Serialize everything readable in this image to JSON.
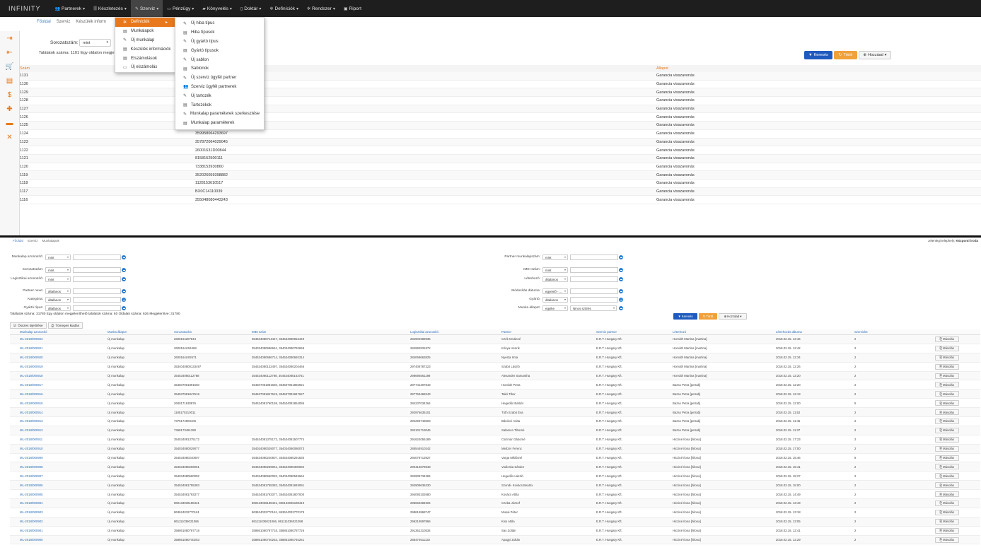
{
  "brand": "INFINITY",
  "nav": [
    {
      "label": "Partnerek",
      "icon": "users-icon"
    },
    {
      "label": "Készletezés",
      "icon": "barcode-icon"
    },
    {
      "label": "Szerviz",
      "icon": "wrench-icon"
    },
    {
      "label": "Pénzügy",
      "icon": "money-icon"
    },
    {
      "label": "Könyvelés",
      "icon": "folder-icon"
    },
    {
      "label": "Doktár",
      "icon": "file-icon"
    },
    {
      "label": "Definíciók",
      "icon": "gear-icon"
    },
    {
      "label": "Rendszer",
      "icon": "gears-icon"
    },
    {
      "label": "Riport",
      "icon": "report-icon"
    }
  ],
  "crumbs": {
    "home": "Főoldal",
    "c2": "Szerviz",
    "c3": "Készülék inform"
  },
  "top": {
    "serial_label": "Sorozatszám:",
    "serial_select": "mint",
    "found": "Találatok száma: 1101 Egy oldalon megje",
    "search": "Keresés",
    "clear": "Töröl",
    "add": "Hozzáad"
  },
  "table1": {
    "col_szam": "Szám",
    "col_allapot": "Állapot",
    "rows": [
      {
        "szam": "1131",
        "serial": "",
        "allapot": "Garancia visszavonás"
      },
      {
        "szam": "1130",
        "serial": "",
        "allapot": "Garancia visszavonás"
      },
      {
        "szam": "1129",
        "serial": "",
        "allapot": "Garancia visszavonás"
      },
      {
        "szam": "1128",
        "serial": "",
        "allapot": "Garancia visszavonás"
      },
      {
        "szam": "1127",
        "serial": "",
        "allapot": "Garancia visszavonás"
      },
      {
        "szam": "1126",
        "serial": "2600791400988",
        "allapot": "Garancia visszavonás"
      },
      {
        "szam": "1125",
        "serial": "352026059383100",
        "allapot": "Garancia visszavonás"
      },
      {
        "szam": "1124",
        "serial": "359958064293697",
        "allapot": "Garancia visszavonás"
      },
      {
        "szam": "1123",
        "serial": "357872064029045",
        "allapot": "Garancia visszavonás"
      },
      {
        "szam": "1122",
        "serial": "26001631D00844",
        "allapot": "Garancia visszavonás"
      },
      {
        "szam": "1121",
        "serial": "8158152500111",
        "allapot": "Garancia visszavonás"
      },
      {
        "szam": "1120",
        "serial": "7338153930860",
        "allapot": "Garancia visszavonás"
      },
      {
        "szam": "1119",
        "serial": "352026059398882",
        "allapot": "Garancia visszavonás"
      },
      {
        "szam": "1118",
        "serial": "1128153610517",
        "allapot": "Garancia visszavonás"
      },
      {
        "szam": "1117",
        "serial": "BX0C14110039",
        "allapot": "Garancia visszavonás"
      },
      {
        "szam": "1116",
        "serial": "355048080443243",
        "allapot": "Garancia visszavonás"
      }
    ]
  },
  "szerviz_menu": [
    {
      "label": "Definíciók",
      "icon": "gear-icon",
      "active": true
    },
    {
      "label": "Munkalapok",
      "icon": "list-icon"
    },
    {
      "label": "Új munkalap",
      "icon": "wrench-icon"
    },
    {
      "label": "Készülék információk",
      "icon": "list-icon"
    },
    {
      "label": "Elszámolások",
      "icon": "list-icon"
    },
    {
      "label": "Új elszámolás",
      "icon": "money-icon"
    }
  ],
  "def_menu": [
    {
      "label": "Új hiba típus",
      "icon": "edit-icon"
    },
    {
      "label": "Hiba típusok",
      "icon": "list-icon"
    },
    {
      "label": "Új gyártó típus",
      "icon": "edit-icon"
    },
    {
      "label": "Gyártó típusok",
      "icon": "list-icon"
    },
    {
      "label": "Új sablon",
      "icon": "edit-icon"
    },
    {
      "label": "Sablonok",
      "icon": "list-icon"
    },
    {
      "label": "Új szerviz ügyfél partner",
      "icon": "edit-icon"
    },
    {
      "label": "Szerviz ügyfél partnerek",
      "icon": "users-icon"
    },
    {
      "label": "Új tartozék",
      "icon": "edit-icon"
    },
    {
      "label": "Tartozékok",
      "icon": "list-icon"
    },
    {
      "label": "Munkalap paraméterek szerkesztése",
      "icon": "edit-icon"
    },
    {
      "label": "Munkalap paraméterek",
      "icon": "list-icon"
    }
  ],
  "p2": {
    "crumbs": {
      "home": "Főoldal",
      "c2": "Szerviz",
      "c3": "Munkalapok"
    },
    "site_label": "Jelenlegi telephely:",
    "site": "Központi iroda",
    "filters_left": [
      {
        "label": "Munkalap azonosító:",
        "select": "mint"
      },
      {
        "label": "Sorozatszám:",
        "select": "mint"
      },
      {
        "label": "Logisztikai azonosító:",
        "select": "mint"
      },
      {
        "label": "Partner neve:",
        "select": "általános"
      },
      {
        "label": "Kategória:",
        "select": "általános"
      },
      {
        "label": "Gyártó típus:",
        "select": "általános"
      }
    ],
    "filters_right": [
      {
        "label": "Partner munkalapszám:",
        "select": "mint"
      },
      {
        "label": "IMEI szám:",
        "select": "mint"
      },
      {
        "label": "Létrehozó:",
        "select": "általános"
      },
      {
        "label": "Módosítás dátuma:",
        "select": "egyenlő - ..."
      },
      {
        "label": "Gyártó:",
        "select": "általános"
      },
      {
        "label": "Munka állapot:",
        "select": "egyike",
        "select2": "Nincs szűrés"
      }
    ],
    "found": "Találatok száma: 31780 Egy oldalon megjeleníthető találatok száma: 60 Oldalak száma: 636 Megjelenítve: 31780",
    "search": "Keresés",
    "clear": "Töröl",
    "add": "Hozzáad",
    "tab1": "Összes kijelölése",
    "tab2": "Tömeges kiadás",
    "headers": [
      "Munkalap azonosító",
      "Munka állapot",
      "Sorozatszám",
      "IMEI szám",
      "Logisztikai azonosító",
      "Partner",
      "Szerviz partner",
      "Létrehozó",
      "Létrehozás dátuma",
      "Szervizlet"
    ],
    "copy": "Másolás",
    "rows": [
      [
        "ML-2018/000922",
        "Új munkalap",
        "2600164207844",
        "354534080714447, 354534080816440",
        "284904968935",
        "Czék Istvánné",
        "E.R.T. Hungary Kft.",
        "Horváth Martina [martina]",
        "2018.02.15. 12:46",
        "2"
      ],
      [
        "ML-2018/000921",
        "Új munkalap",
        "2600164U04468",
        "354034080686661, 354034080782669",
        "284992831872",
        "Kónya Henrik",
        "E.R.T. Hungary Kft.",
        "Horváth Martina [martina]",
        "2018.02.15. 12:42",
        "2"
      ],
      [
        "ML-2018/000920",
        "Új munkalap",
        "2600164U02671",
        "354534080686714, 354534080692314",
        "284068663825",
        "Nyesta Irma",
        "E.R.T. Hungary Kft.",
        "Horváth Martina [martina]",
        "2018.02.15. 12:34",
        "2"
      ],
      [
        "ML-2018/000919",
        "Új munkalap",
        "3534040800133497",
        "354534080132497, 354534080204466",
        "297408787223",
        "Szabó László",
        "E.R.T. Hungary Kft.",
        "Horváth Martina [martina]",
        "2018.02.15. 12:26",
        "2"
      ],
      [
        "ML-2018/000918",
        "Új munkalap",
        "354534080112788",
        "354534080112788, 354534080163751",
        "298695561198",
        "Alexander Samantha",
        "E.R.T. Hungary Kft.",
        "Horváth Martina [martina]",
        "2018.02.15. 12:20",
        "2"
      ],
      [
        "ML-2018/000917",
        "Új munkalap",
        "354507061891660",
        "354507061891660, 354507061892921",
        "287741307843",
        "Horváth Petra",
        "E.R.T. Hungary Kft.",
        "Bazso Petra [petrab]",
        "2018.02.15. 12:20",
        "2"
      ],
      [
        "ML-2018/000916",
        "Új munkalap",
        "354537081847619",
        "354537081847619, 354537081847627",
        "297763468243",
        "Takó Tibor",
        "E.R.T. Hungary Kft.",
        "Bazso Petra [petrab]",
        "2018.02.15. 12:13",
        "2"
      ],
      [
        "ML-2018/000915",
        "Új munkalap",
        "2600171630876",
        "354534081760159, 354534081854086",
        "284237034264",
        "Hegedűs Balázs",
        "E.R.T. Hungary Kft.",
        "Bazso Petra [petrab]",
        "2018.02.15. 12:00",
        "5"
      ],
      [
        "ML-2018/000914",
        "Új munkalap",
        "1185170210011",
        "",
        "292976635101",
        "Tóth Szabó Éva",
        "E.R.T. Hungary Kft.",
        "Bazso Petra [petrab]",
        "2018.02.15. 11:52",
        "2"
      ],
      [
        "ML-2018/000913",
        "Új munkalap",
        "7375174903106",
        "",
        "284293743503",
        "Bánóczi Anita",
        "E.R.T. Hungary Kft.",
        "Bazso Petra [petrab]",
        "2018.02.15. 11:45",
        "2"
      ],
      [
        "ML-2018/000912",
        "Új munkalap",
        "7368173491390",
        "",
        "292101713046",
        "Salamon Tiborné",
        "E.R.T. Hungary Kft.",
        "Bazso Petra [petrab]",
        "2018.02.15. 11:37",
        "2"
      ],
      [
        "ML-2018/000911",
        "Új munkalap",
        "354534081375172",
        "354534081375172, 354534081507774",
        "291624055189",
        "Csizmár Gáborné",
        "E.R.T. Hungary Kft.",
        "Hicziné Ilona [hilona]",
        "2018.02.15. 17:23",
        "2"
      ],
      [
        "ML-2018/000910",
        "Új munkalap",
        "354034080029077",
        "354034080029077, 354034080080073",
        "285544910242",
        "Mettzer Ferenc",
        "E.R.T. Hungary Kft.",
        "Hicziné Ilona [hilona]",
        "2018.02.15. 17:00",
        "2"
      ],
      [
        "ML-2018/000909",
        "Új munkalap",
        "354534080240807",
        "354534080240807, 354534080291830",
        "294078713927",
        "Varga Miklósné",
        "E.R.T. Hungary Kft.",
        "Hicziné Ilona [hilona]",
        "2018.02.15. 15:46",
        "6"
      ],
      [
        "ML-2018/000908",
        "Új munkalap",
        "354534080269061",
        "354534080269061, 354534080300082",
        "290415678948",
        "Vodicska Sándor",
        "E.R.T. Hungary Kft.",
        "Hicziné Ilona [hilona]",
        "2018.02.15. 15:41",
        "2"
      ],
      [
        "ML-2018/000907",
        "Új munkalap",
        "354034080660082",
        "354034080660082, 354034080545664",
        "292909734284",
        "Hegedűs László",
        "E.R.T. Hungary Kft.",
        "Hicziné Ilona [hilona]",
        "2018.02.15. 15:27",
        "2"
      ],
      [
        "ML-2018/000906",
        "Új munkalap",
        "354534081755383",
        "354534081755383, 354534081849091",
        "292909636330",
        "Szondi- Kovács Beatrix",
        "E.R.T. Hungary Kft.",
        "Hicziné Ilona [hilona]",
        "2018.02.15. 15:00",
        "2"
      ],
      [
        "ML-2018/000905",
        "Új munkalap",
        "354534081793377",
        "354534081793377, 354534081807000",
        "294093102680",
        "Kovács Attila",
        "E.R.T. Hungary Kft.",
        "Hicziné Ilona [hilona]",
        "2018.02.15. 14:49",
        "2"
      ],
      [
        "ML-2018/000904",
        "Új munkalap",
        "860133036188421",
        "860133036188421, 860133036188419",
        "286663384504",
        "Czeba József",
        "E.R.T. Hungary Kft.",
        "Hicziné Ilona [hilona]",
        "2018.02.15. 13:43",
        "2"
      ],
      [
        "ML-2018/000903",
        "Új munkalap",
        "863624032770161",
        "863624032770161, 863624032770179",
        "298619968747",
        "Musai Péter",
        "E.R.T. Hungary Kft.",
        "Hicziné Ilona [hilona]",
        "2018.02.15. 13:18",
        "2"
      ],
      [
        "ML-2018/000902",
        "Új munkalap",
        "861111036021066",
        "861111036021066, 861111036021058",
        "296219597866",
        "Kiss Attila",
        "E.R.T. Hungary Kft.",
        "Hicziné Ilona [hilona]",
        "2018.02.15. 13:05",
        "2"
      ],
      [
        "ML-2018/000901",
        "Új munkalap",
        "358861080787718",
        "358861080787718, 358861080787726",
        "291361210534",
        "Sas Zoltán",
        "E.R.T. Hungary Kft.",
        "Hicziné Ilona [hilona]",
        "2018.02.15. 12:41",
        "2"
      ],
      [
        "ML-2018/000900",
        "Új munkalap",
        "358861080740253",
        "358861080740253, 358861080740261",
        "288474611132",
        "Apagyi Zoltán",
        "E.R.T. Hungary Kft.",
        "Hicziné Ilona [hilona]",
        "2018.02.15. 12:29",
        "2"
      ]
    ]
  }
}
